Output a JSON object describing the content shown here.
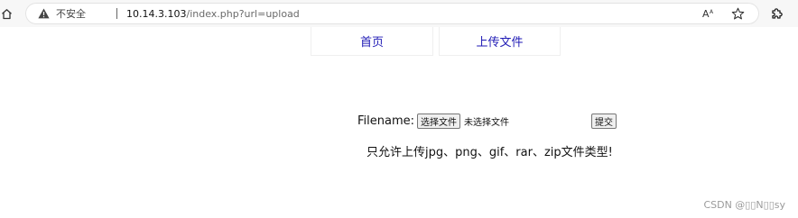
{
  "browser": {
    "security_text": "不安全",
    "url_host": "10.14.3.103",
    "url_path": "/index.php?url=upload",
    "read_aloud_label": "Aᴬ",
    "icons": {
      "home": "home-icon",
      "warning": "warning-triangle-icon",
      "favorite": "star-icon",
      "extensions": "puzzle-icon"
    }
  },
  "nav": {
    "home_label": "首页",
    "upload_label": "上传文件",
    "link_color": "#1f1ab5"
  },
  "form": {
    "label": "Filename:",
    "choose_file_label": "选择文件",
    "file_status": "未选择文件",
    "submit_label": "提交"
  },
  "notice": "只允许上传jpg、png、gif、rar、zip文件类型!",
  "watermark": "CSDN @▯▯N▯▯sy"
}
